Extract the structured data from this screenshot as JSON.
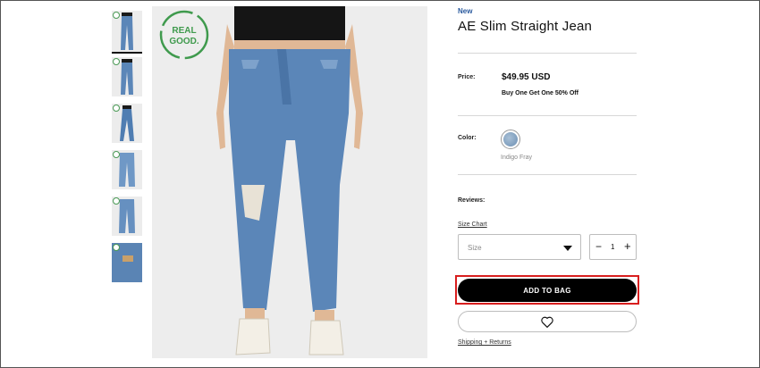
{
  "product": {
    "badge": "New",
    "title": "AE Slim Straight Jean",
    "eco_badge": {
      "line1": "REAL",
      "line2": "GOOD."
    }
  },
  "price": {
    "label": "Price:",
    "value": "$49.95 USD",
    "promo": "Buy One Get One 50% Off"
  },
  "color": {
    "label": "Color:",
    "selected_name": "Indigo Fray",
    "swatch_hex": "#7f9fc0"
  },
  "reviews": {
    "label": "Reviews:"
  },
  "size": {
    "chart_link": "Size Chart",
    "placeholder": "Size"
  },
  "quantity": {
    "minus": "−",
    "value": "1",
    "plus": "+"
  },
  "actions": {
    "add_to_bag": "ADD TO BAG",
    "shipping_link": "Shipping + Returns"
  },
  "thumbnails": [
    {
      "name": "front-full",
      "active": true
    },
    {
      "name": "front-full-2",
      "active": false
    },
    {
      "name": "side",
      "active": false
    },
    {
      "name": "flat-front",
      "active": false
    },
    {
      "name": "flat-back",
      "active": false
    },
    {
      "name": "pocket-detail",
      "active": false
    }
  ],
  "colors": {
    "accent_blue": "#2a5a9e",
    "eco_green": "#3f9a4d",
    "highlight_red": "#d81e1e",
    "button_black": "#000000"
  }
}
